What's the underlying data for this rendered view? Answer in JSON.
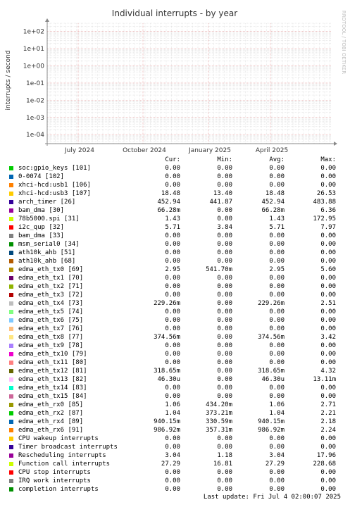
{
  "chart_data": {
    "type": "line",
    "title": "Individual interrupts - by year",
    "ylabel": "interrupts / second",
    "y_scale": "log",
    "y_ticks": [
      "1e-04",
      "1e-03",
      "1e-02",
      "1e-01",
      "1e+00",
      "1e+01",
      "1e+02"
    ],
    "ylim": [
      3e-05,
      300
    ],
    "x_ticks": [
      "July 2024",
      "October 2024",
      "January 2025",
      "April 2025"
    ],
    "grid": true,
    "watermark": "RRDTOOL / TOBI OETIKER",
    "colors": {
      "grid_major": "#e8a0a0",
      "grid_minor": "#d8d8d8",
      "plot_bg": "#ffffff",
      "axis": "#888888"
    }
  },
  "legend": {
    "headers": {
      "cur": "Cur:",
      "min": "Min:",
      "avg": "Avg:",
      "max": "Max:"
    },
    "rows": [
      {
        "name": "soc:gpio_keys [101]",
        "color": "#00cc00",
        "cur": "0.00",
        "min": "0.00",
        "avg": "0.00",
        "max": "0.00"
      },
      {
        "name": "0-0074 [102]",
        "color": "#0066b3",
        "cur": "0.00",
        "min": "0.00",
        "avg": "0.00",
        "max": "0.00"
      },
      {
        "name": "xhci-hcd:usb1 [106]",
        "color": "#ff8000",
        "cur": "0.00",
        "min": "0.00",
        "avg": "0.00",
        "max": "0.00"
      },
      {
        "name": "xhci-hcd:usb3 [107]",
        "color": "#ffcc00",
        "cur": "18.48",
        "min": "13.40",
        "avg": "18.48",
        "max": "26.53"
      },
      {
        "name": "arch_timer [26]",
        "color": "#330099",
        "cur": "452.94",
        "min": "441.87",
        "avg": "452.94",
        "max": "483.88"
      },
      {
        "name": "bam_dma [30]",
        "color": "#990099",
        "cur": "66.28m",
        "min": "0.00",
        "avg": "66.28m",
        "max": "6.36"
      },
      {
        "name": "78b5000.spi [31]",
        "color": "#ccff00",
        "cur": "1.43",
        "min": "0.00",
        "avg": "1.43",
        "max": "172.95"
      },
      {
        "name": "i2c_qup [32]",
        "color": "#ff0000",
        "cur": "5.71",
        "min": "3.84",
        "avg": "5.71",
        "max": "7.97"
      },
      {
        "name": "bam_dma [33]",
        "color": "#808080",
        "cur": "0.00",
        "min": "0.00",
        "avg": "0.00",
        "max": "0.00"
      },
      {
        "name": "msm_serial0 [34]",
        "color": "#008f00",
        "cur": "0.00",
        "min": "0.00",
        "avg": "0.00",
        "max": "0.00"
      },
      {
        "name": "ath10k_ahb [51]",
        "color": "#00487d",
        "cur": "0.00",
        "min": "0.00",
        "avg": "0.00",
        "max": "0.00"
      },
      {
        "name": "ath10k_ahb [68]",
        "color": "#b35a00",
        "cur": "0.00",
        "min": "0.00",
        "avg": "0.00",
        "max": "0.00"
      },
      {
        "name": "edma_eth_tx0 [69]",
        "color": "#b38f00",
        "cur": "2.95",
        "min": "541.70m",
        "avg": "2.95",
        "max": "5.60"
      },
      {
        "name": "edma_eth_tx1 [70]",
        "color": "#6b006b",
        "cur": "0.00",
        "min": "0.00",
        "avg": "0.00",
        "max": "0.00"
      },
      {
        "name": "edma_eth_tx2 [71]",
        "color": "#8fb300",
        "cur": "0.00",
        "min": "0.00",
        "avg": "0.00",
        "max": "0.00"
      },
      {
        "name": "edma_eth_tx3 [72]",
        "color": "#b30000",
        "cur": "0.00",
        "min": "0.00",
        "avg": "0.00",
        "max": "0.00"
      },
      {
        "name": "edma_eth_tx4 [73]",
        "color": "#bebebe",
        "cur": "229.26m",
        "min": "0.00",
        "avg": "229.26m",
        "max": "2.51"
      },
      {
        "name": "edma_eth_tx5 [74]",
        "color": "#80ff80",
        "cur": "0.00",
        "min": "0.00",
        "avg": "0.00",
        "max": "0.00"
      },
      {
        "name": "edma_eth_tx6 [75]",
        "color": "#80c9ff",
        "cur": "0.00",
        "min": "0.00",
        "avg": "0.00",
        "max": "0.00"
      },
      {
        "name": "edma_eth_tx7 [76]",
        "color": "#ffc080",
        "cur": "0.00",
        "min": "0.00",
        "avg": "0.00",
        "max": "0.00"
      },
      {
        "name": "edma_eth_tx8 [77]",
        "color": "#ffe680",
        "cur": "374.56m",
        "min": "0.00",
        "avg": "374.56m",
        "max": "3.42"
      },
      {
        "name": "edma_eth_tx9 [78]",
        "color": "#aa80ff",
        "cur": "0.00",
        "min": "0.00",
        "avg": "0.00",
        "max": "0.00"
      },
      {
        "name": "edma_eth_tx10 [79]",
        "color": "#ee00cc",
        "cur": "0.00",
        "min": "0.00",
        "avg": "0.00",
        "max": "0.00"
      },
      {
        "name": "edma_eth_tx11 [80]",
        "color": "#ff8080",
        "cur": "0.00",
        "min": "0.00",
        "avg": "0.00",
        "max": "0.00"
      },
      {
        "name": "edma_eth_tx12 [81]",
        "color": "#666600",
        "cur": "318.65m",
        "min": "0.00",
        "avg": "318.65m",
        "max": "4.32"
      },
      {
        "name": "edma_eth_tx13 [82]",
        "color": "#ffbfff",
        "cur": "46.30u",
        "min": "0.00",
        "avg": "46.30u",
        "max": "13.11m"
      },
      {
        "name": "edma_eth_tx14 [83]",
        "color": "#00ffcc",
        "cur": "0.00",
        "min": "0.00",
        "avg": "0.00",
        "max": "0.00"
      },
      {
        "name": "edma_eth_tx15 [84]",
        "color": "#cc6699",
        "cur": "0.00",
        "min": "0.00",
        "avg": "0.00",
        "max": "0.00"
      },
      {
        "name": "edma_eth_rx0 [85]",
        "color": "#999900",
        "cur": "1.06",
        "min": "434.20m",
        "avg": "1.06",
        "max": "2.71"
      },
      {
        "name": "edma_eth_rx2 [87]",
        "color": "#00cc00",
        "cur": "1.04",
        "min": "373.21m",
        "avg": "1.04",
        "max": "2.21"
      },
      {
        "name": "edma_eth_rx4 [89]",
        "color": "#0066b3",
        "cur": "940.15m",
        "min": "330.59m",
        "avg": "940.15m",
        "max": "2.18"
      },
      {
        "name": "edma_eth_rx6 [91]",
        "color": "#ff8000",
        "cur": "986.92m",
        "min": "357.31m",
        "avg": "986.92m",
        "max": "2.24"
      },
      {
        "name": "CPU wakeup interrupts",
        "color": "#ffcc00",
        "cur": "0.00",
        "min": "0.00",
        "avg": "0.00",
        "max": "0.00"
      },
      {
        "name": "Timer broadcast interrupts",
        "color": "#330099",
        "cur": "0.00",
        "min": "0.00",
        "avg": "0.00",
        "max": "0.00"
      },
      {
        "name": "Rescheduling interrupts",
        "color": "#990099",
        "cur": "3.04",
        "min": "1.18",
        "avg": "3.04",
        "max": "17.96"
      },
      {
        "name": "Function call interrupts",
        "color": "#ccff00",
        "cur": "27.29",
        "min": "16.81",
        "avg": "27.29",
        "max": "228.68"
      },
      {
        "name": "CPU stop interrupts",
        "color": "#ff0000",
        "cur": "0.00",
        "min": "0.00",
        "avg": "0.00",
        "max": "0.00"
      },
      {
        "name": "IRQ work interrupts",
        "color": "#808080",
        "cur": "0.00",
        "min": "0.00",
        "avg": "0.00",
        "max": "0.00"
      },
      {
        "name": "completion interrupts",
        "color": "#008f00",
        "cur": "0.00",
        "min": "0.00",
        "avg": "0.00",
        "max": "0.00"
      }
    ]
  },
  "footer": {
    "last_update": "Last update: Fri Jul  4 02:00:07 2025"
  }
}
